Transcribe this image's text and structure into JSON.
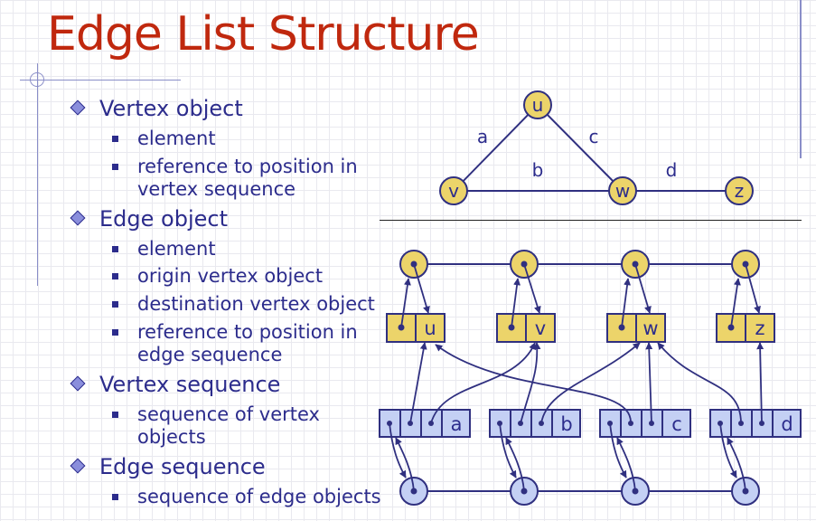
{
  "title": "Edge List Structure",
  "outline": [
    {
      "text": "Vertex object",
      "children": [
        "element",
        "reference to position in\nvertex sequence"
      ]
    },
    {
      "text": "Edge object",
      "children": [
        "element",
        "origin vertex object",
        "destination vertex object",
        "reference to position in\nedge sequence"
      ]
    },
    {
      "text": "Vertex sequence",
      "children": [
        "sequence of vertex\nobjects"
      ]
    },
    {
      "text": "Edge sequence",
      "children": [
        "sequence of edge objects"
      ]
    }
  ],
  "graph": {
    "vertices": [
      "u",
      "v",
      "w",
      "z"
    ],
    "edges": [
      {
        "label": "a",
        "from": "u",
        "to": "v"
      },
      {
        "label": "b",
        "from": "v",
        "to": "w"
      },
      {
        "label": "c",
        "from": "u",
        "to": "w"
      },
      {
        "label": "d",
        "from": "w",
        "to": "z"
      }
    ]
  },
  "structure": {
    "vertex_elements": [
      "u",
      "v",
      "w",
      "z"
    ],
    "edge_elements": [
      "a",
      "b",
      "c",
      "d"
    ]
  },
  "colors": {
    "title": "#c0280e",
    "text": "#2c2c8c",
    "vertex_fill": "#ecd46a",
    "edge_box_fill": "#c4d0f4",
    "sequence_node_fill": "#c4d0f4",
    "line": "#303080"
  }
}
